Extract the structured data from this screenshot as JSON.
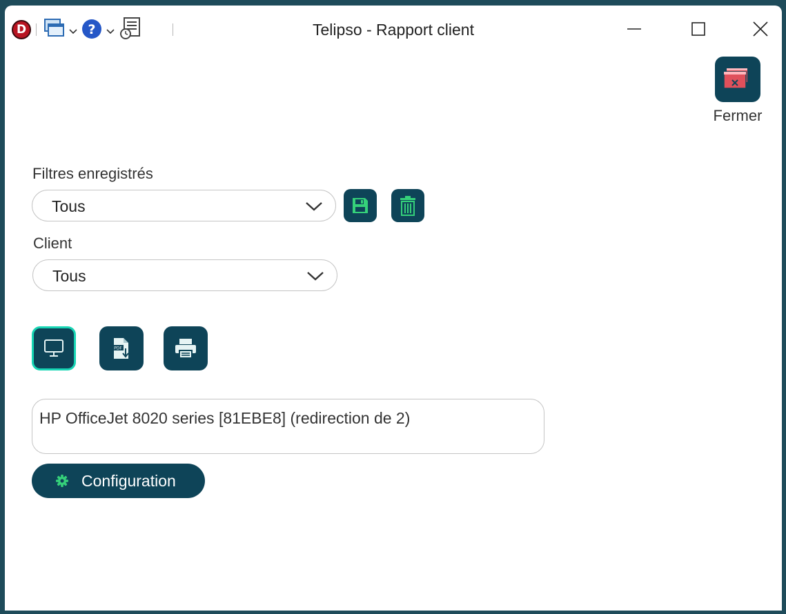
{
  "window": {
    "title": "Telipso - Rapport client",
    "app_logo_letter": "D"
  },
  "toolbar": {
    "icons": [
      "app-logo-icon",
      "windows-icon",
      "help-icon",
      "document-icon"
    ]
  },
  "close_button": {
    "label": "Fermer",
    "icon": "close-window-icon"
  },
  "saved_filters": {
    "label": "Filtres enregistrés",
    "selected": "Tous",
    "actions": [
      "save-icon",
      "trash-icon"
    ]
  },
  "client": {
    "label": "Client",
    "selected": "Tous"
  },
  "output_buttons": [
    {
      "icon": "monitor-icon",
      "active": true
    },
    {
      "icon": "pdf-icon",
      "active": false
    },
    {
      "icon": "printer-icon",
      "active": false
    }
  ],
  "printer": {
    "value": "HP OfficeJet 8020 series [81EBE8] (redirection de 2)"
  },
  "config_button": {
    "label": "Configuration",
    "icon": "gear-icon"
  },
  "colors": {
    "primary": "#0e4458",
    "accent_green": "#35d17a",
    "active_border": "#17d5b4",
    "close_icon_red": "#e0505b"
  }
}
